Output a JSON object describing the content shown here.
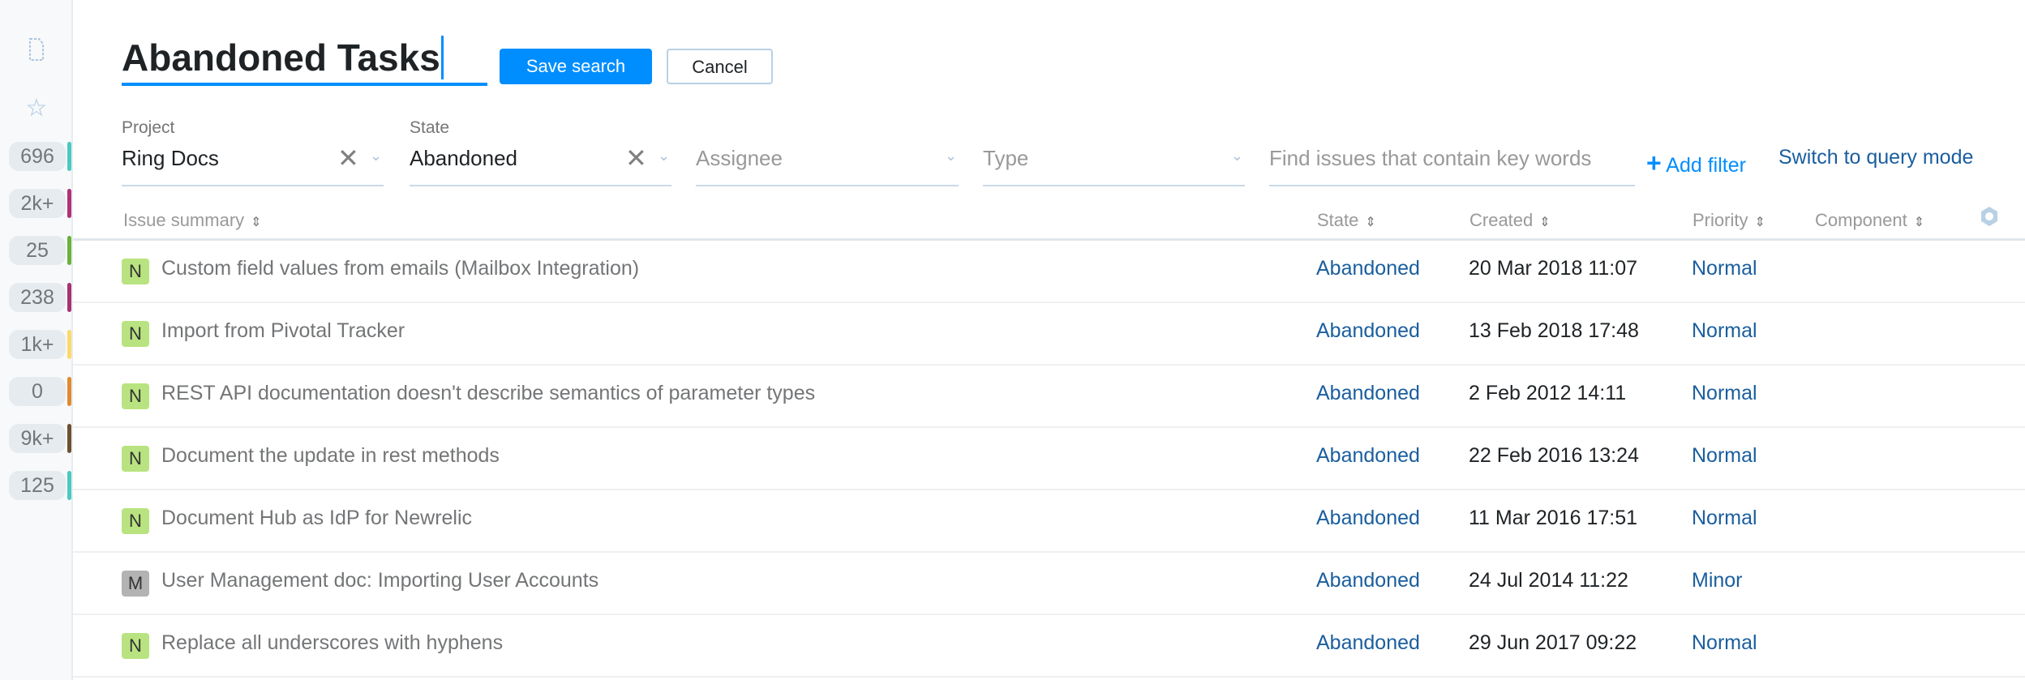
{
  "sidebar": {
    "icons": [
      "document-icon",
      "star-icon"
    ],
    "counters": [
      {
        "value": "696",
        "color": "#4cc9c0"
      },
      {
        "value": "2k+",
        "color": "#b0307a"
      },
      {
        "value": "25",
        "color": "#6ab23a"
      },
      {
        "value": "238",
        "color": "#a8326f"
      },
      {
        "value": "1k+",
        "color": "#fcd86a"
      },
      {
        "value": "0",
        "color": "#e08a30"
      },
      {
        "value": "9k+",
        "color": "#6e5030"
      },
      {
        "value": "125",
        "color": "#4cc9c0"
      }
    ]
  },
  "header": {
    "title": "Abandoned Tasks",
    "save_label": "Save search",
    "cancel_label": "Cancel"
  },
  "filters": {
    "project": {
      "label": "Project",
      "value": "Ring Docs"
    },
    "state": {
      "label": "State",
      "value": "Abandoned"
    },
    "assignee": {
      "placeholder": "Assignee"
    },
    "type": {
      "placeholder": "Type"
    },
    "search": {
      "placeholder": "Find issues that contain key words"
    },
    "add_filter": "Add filter",
    "switch_mode": "Switch to query mode"
  },
  "columns": {
    "summary": "Issue summary",
    "state": "State",
    "created": "Created",
    "priority": "Priority",
    "component": "Component"
  },
  "colors": {
    "accent": "#008eff",
    "badge_normal": "#b9e380",
    "badge_minor": "#b3b3b3"
  },
  "issues": [
    {
      "badge": "N",
      "summary": "Custom field values from emails (Mailbox Integration)",
      "state": "Abandoned",
      "created": "20 Mar 2018 11:07",
      "priority": "Normal"
    },
    {
      "badge": "N",
      "summary": "Import from Pivotal Tracker",
      "state": "Abandoned",
      "created": "13 Feb 2018 17:48",
      "priority": "Normal"
    },
    {
      "badge": "N",
      "summary": "REST API documentation doesn't describe semantics of parameter types",
      "state": "Abandoned",
      "created": "2 Feb 2012 14:11",
      "priority": "Normal"
    },
    {
      "badge": "N",
      "summary": "Document the update in rest methods",
      "state": "Abandoned",
      "created": "22 Feb 2016 13:24",
      "priority": "Normal"
    },
    {
      "badge": "N",
      "summary": "Document Hub as IdP for Newrelic",
      "state": "Abandoned",
      "created": "11 Mar 2016 17:51",
      "priority": "Normal"
    },
    {
      "badge": "M",
      "summary": "User Management doc: Importing User Accounts",
      "state": "Abandoned",
      "created": "24 Jul 2014 11:22",
      "priority": "Minor"
    },
    {
      "badge": "N",
      "summary": "Replace all underscores with hyphens",
      "state": "Abandoned",
      "created": "29 Jun 2017 09:22",
      "priority": "Normal"
    }
  ]
}
